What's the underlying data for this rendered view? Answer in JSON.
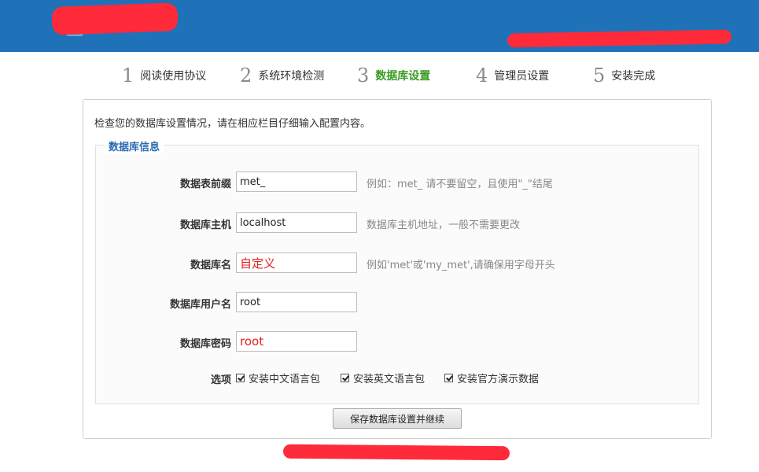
{
  "steps": [
    {
      "num": "1",
      "label": "阅读使用协议"
    },
    {
      "num": "2",
      "label": "系统环境检测"
    },
    {
      "num": "3",
      "label": "数据库设置"
    },
    {
      "num": "4",
      "label": "管理员设置"
    },
    {
      "num": "5",
      "label": "安装完成"
    }
  ],
  "active_step": 3,
  "panel": {
    "intro": "检查您的数据库设置情况，请在相应栏目仔细输入配置内容。",
    "legend": "数据库信息",
    "fields": [
      {
        "label": "数据表前缀",
        "value": "met_",
        "hint": "例如：met_ 请不要留空，且使用\"_\"结尾"
      },
      {
        "label": "数据库主机",
        "value": "localhost",
        "hint": "数据库主机地址，一般不需要更改"
      },
      {
        "label": "数据库名",
        "value": "自定义",
        "hint": "例如'met'或'my_met',请确保用字母开头"
      },
      {
        "label": "数据库用户名",
        "value": "root",
        "hint": ""
      },
      {
        "label": "数据库密码",
        "value": "root",
        "hint": ""
      }
    ],
    "options_label": "选项",
    "options": [
      {
        "label": "安装中文语言包",
        "checked": true
      },
      {
        "label": "安装英文语言包",
        "checked": true
      },
      {
        "label": "安装官方演示数据",
        "checked": true
      }
    ],
    "submit_label": "保存数据库设置并继续"
  },
  "colors": {
    "header_bg": "#1f72b8",
    "active_step": "#3a9b22",
    "legend": "#2a6ab0",
    "redaction": "#ff2a3a",
    "annotation_red": "#e02020"
  }
}
